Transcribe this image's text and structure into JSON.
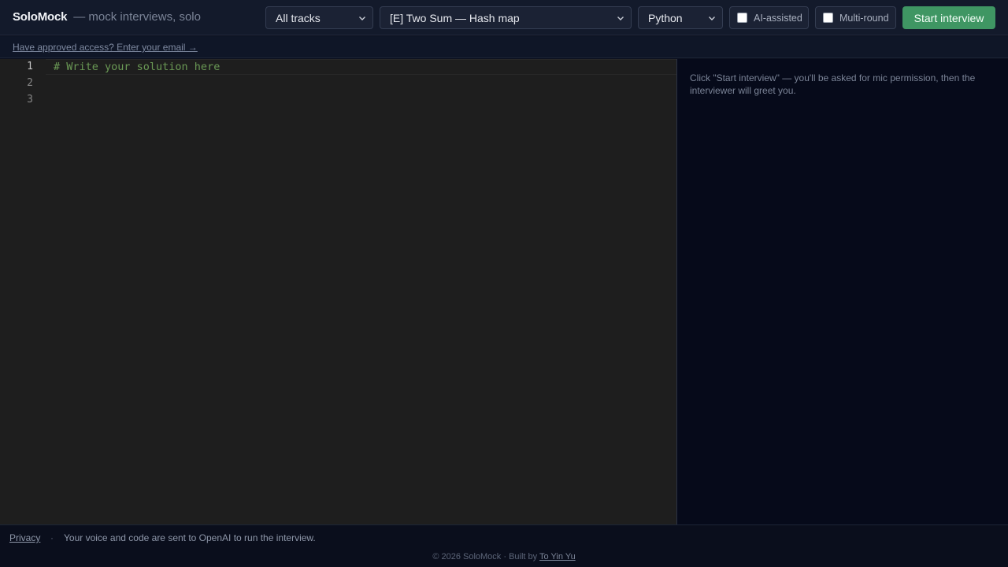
{
  "header": {
    "brand": "SoloMock",
    "tagline": "— mock interviews, solo",
    "track_select": {
      "value": "All tracks"
    },
    "problem_select": {
      "value": "[E] Two Sum — Hash map"
    },
    "language_select": {
      "value": "Python"
    },
    "ai_assisted": {
      "label": "AI-assisted",
      "checked": false
    },
    "multi_round": {
      "label": "Multi-round",
      "checked": false
    },
    "start_button": "Start interview"
  },
  "access": {
    "link": "Have approved access? Enter your email →"
  },
  "editor": {
    "line_numbers": [
      "1",
      "2",
      "3"
    ],
    "lines": [
      "# Write your solution here",
      "",
      ""
    ]
  },
  "side_panel": {
    "hint": "Click \"Start interview\" — you'll be asked for mic permission, then the interviewer will greet you."
  },
  "footer": {
    "privacy": "Privacy",
    "separator": "·",
    "disclaimer": "Your voice and code are sent to OpenAI to run the interview.",
    "copyright_prefix": "© 2026 SoloMock · Built by ",
    "author": "To Yin Yu"
  },
  "colors": {
    "accent_green": "#3f9663",
    "editor_bg": "#1e1e1e",
    "panel_bg": "#060a1a",
    "comment": "#6a9955"
  }
}
